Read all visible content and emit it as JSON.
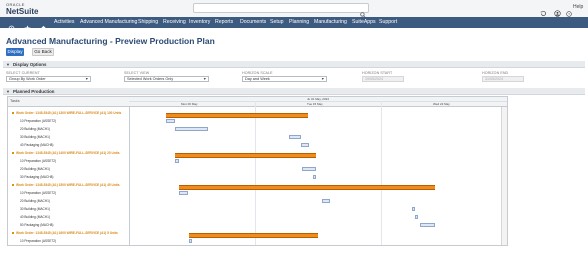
{
  "header": {
    "logo_top": "ORACLE",
    "logo_main": "NetSuite",
    "search_placeholder": "",
    "help": "Help"
  },
  "nav": {
    "items": [
      "Activities",
      "Advanced Manufacturing",
      "Shipping",
      "Receiving",
      "Inventory",
      "Reports",
      "Documents",
      "Setup",
      "Planning",
      "Manufacturing",
      "SuiteApps",
      "Support"
    ]
  },
  "page": {
    "title": "Advanced Manufacturing - Preview Production Plan",
    "display_button": "Display",
    "goback_button": "Go Back"
  },
  "display_options": {
    "title": "Display Options",
    "fields": [
      {
        "label": "SELECT CURRENT",
        "value": "Group By Work Order"
      },
      {
        "label": "SELECT VIEW",
        "value": "Selected Work Orders Only"
      },
      {
        "label": "HORIZON SCALE",
        "value": "Day and Week"
      },
      {
        "label": "HORIZON START",
        "value": "19/05/2024"
      },
      {
        "label": "HORIZON END",
        "value": "31/05/2024"
      }
    ]
  },
  "planned_production": {
    "title": "Planned Production",
    "tasks_header": "Tasks",
    "month_label": "Ju 01 May, 2024",
    "days": [
      "Mon 06 May",
      "Tue 15 May",
      "Wed 22 May"
    ],
    "rows": [
      {
        "label": "Work Order: 1345-5345 (A1) 1300 WIRE-FULL-SERVICE (A1) 100 Units",
        "type": "wo"
      },
      {
        "label": "10 Preparation (ASSET2)",
        "type": "op"
      },
      {
        "label": "20 Building (MACH1)",
        "type": "op"
      },
      {
        "label": "30 Building (MACH1)",
        "type": "op"
      },
      {
        "label": "40 Packaging (MACH8)",
        "type": "op"
      },
      {
        "label": "Work Order: 1345-5345 (A1) 1400 WIRE-FULL-SERVICE (A1) 20 Units",
        "type": "wo"
      },
      {
        "label": "10 Preparation (ASSET2)",
        "type": "op"
      },
      {
        "label": "20 Building (MACH1)",
        "type": "op"
      },
      {
        "label": "30 Packaging (MACH8)",
        "type": "op"
      },
      {
        "label": "Work Order: 1345-5345 (A1) 1500 WIRE-FULL-SERVICE (A1) 45 Units",
        "type": "wo"
      },
      {
        "label": "10 Preparation (ASSET2)",
        "type": "op"
      },
      {
        "label": "20 Building (MACH1)",
        "type": "op"
      },
      {
        "label": "30 Building (MACH1)",
        "type": "op"
      },
      {
        "label": "40 Building (MACH1)",
        "type": "op"
      },
      {
        "label": "50 Packaging (MACH8)",
        "type": "op"
      },
      {
        "label": "Work Order: 1345-5345 (A1) 1600 WIRE-FULL-SERVICE (A1) 5 Units",
        "type": "wo"
      },
      {
        "label": "10 Preparation (ASSET2)",
        "type": "op"
      }
    ]
  },
  "colors": {
    "nav_bg": "#3d5a80",
    "title": "#2a4a75",
    "work_order_bar": "#f08c1e",
    "operation_bar": "#dde7f5",
    "primary_button": "#2f6fc1"
  }
}
